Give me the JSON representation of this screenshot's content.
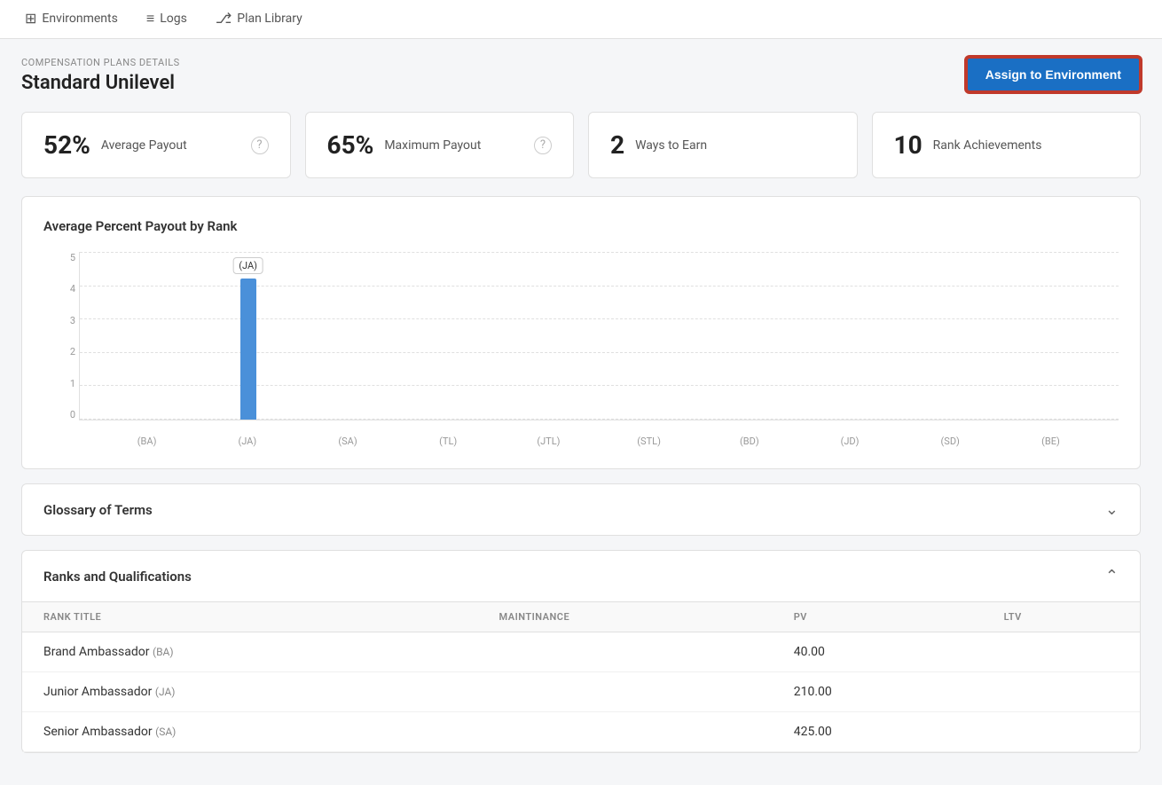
{
  "nav": {
    "items": [
      {
        "id": "environments",
        "label": "Environments",
        "icon": "⊞"
      },
      {
        "id": "logs",
        "label": "Logs",
        "icon": "≡"
      },
      {
        "id": "plan-library",
        "label": "Plan Library",
        "icon": "⎇"
      }
    ]
  },
  "header": {
    "breadcrumb": "COMPENSATION PLANS DETAILS",
    "title": "Standard Unilevel",
    "assign_button": "Assign to Environment"
  },
  "stats": [
    {
      "id": "avg-payout",
      "value": "52%",
      "label": "Average Payout",
      "has_help": true
    },
    {
      "id": "max-payout",
      "value": "65%",
      "label": "Maximum Payout",
      "has_help": true
    },
    {
      "id": "ways-to-earn",
      "value": "2",
      "label": "Ways to Earn",
      "has_help": false
    },
    {
      "id": "rank-achievements",
      "value": "10",
      "label": "Rank Achievements",
      "has_help": false
    }
  ],
  "chart": {
    "title": "Average Percent Payout by Rank",
    "y_labels": [
      "5",
      "4",
      "3",
      "2",
      "1",
      "0"
    ],
    "x_labels": [
      "(BA)",
      "(JA)",
      "(SA)",
      "(TL)",
      "(JTL)",
      "(STL)",
      "(BD)",
      "(JD)",
      "(SD)",
      "(BE)"
    ],
    "bars": [
      {
        "rank": "BA",
        "value": 0,
        "height_pct": 0
      },
      {
        "rank": "JA",
        "value": 4.2,
        "height_pct": 84,
        "tooltip": "(JA)"
      },
      {
        "rank": "SA",
        "value": 0,
        "height_pct": 0
      },
      {
        "rank": "TL",
        "value": 0,
        "height_pct": 0
      },
      {
        "rank": "JTL",
        "value": 0,
        "height_pct": 0
      },
      {
        "rank": "STL",
        "value": 0,
        "height_pct": 0
      },
      {
        "rank": "BD",
        "value": 0,
        "height_pct": 0
      },
      {
        "rank": "JD",
        "value": 0,
        "height_pct": 0
      },
      {
        "rank": "SD",
        "value": 0,
        "height_pct": 0
      },
      {
        "rank": "BE",
        "value": 0,
        "height_pct": 0
      }
    ]
  },
  "glossary": {
    "title": "Glossary of Terms",
    "expanded": false
  },
  "ranks": {
    "title": "Ranks and Qualifications",
    "expanded": true,
    "columns": [
      "RANK TITLE",
      "MAINTINANCE",
      "PV",
      "LTV"
    ],
    "rows": [
      {
        "title": "Brand Ambassador",
        "abbr": "BA",
        "maintenance": "",
        "pv": "40.00",
        "ltv": ""
      },
      {
        "title": "Junior Ambassador",
        "abbr": "JA",
        "maintenance": "",
        "pv": "210.00",
        "ltv": ""
      },
      {
        "title": "Senior Ambassador",
        "abbr": "SA",
        "maintenance": "",
        "pv": "425.00",
        "ltv": ""
      }
    ]
  }
}
